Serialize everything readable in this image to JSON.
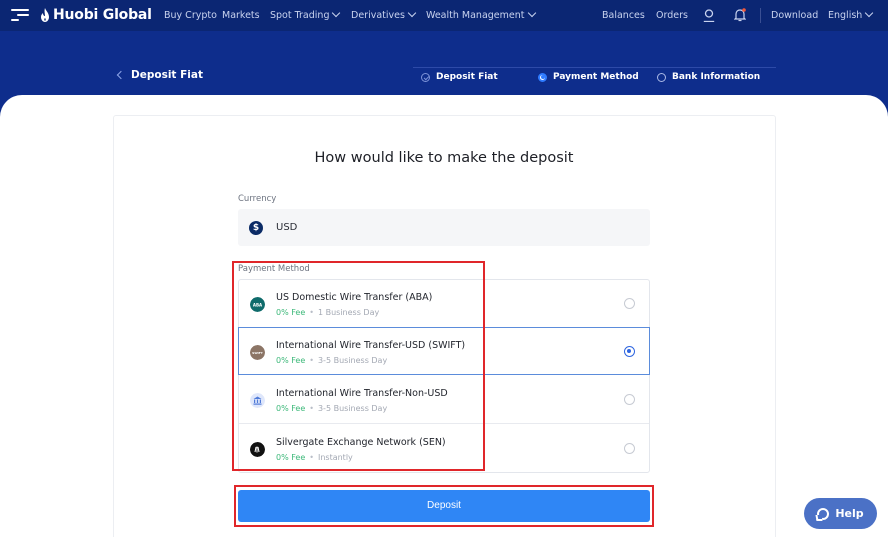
{
  "nav": {
    "brand": "Huobi Global",
    "items": [
      "Buy Crypto",
      "Markets",
      "Spot Trading",
      "Derivatives",
      "Wealth Management"
    ],
    "right": [
      "Balances",
      "Orders",
      "Download",
      "English"
    ]
  },
  "banner": {
    "back_label": "Deposit Fiat",
    "steps": [
      "Deposit Fiat",
      "Payment Method",
      "Bank Information"
    ]
  },
  "form": {
    "heading": "How would like to make the deposit",
    "currency_label": "Currency",
    "currency_value": "USD",
    "payment_label": "Payment Method",
    "methods": [
      {
        "title": "US Domestic Wire Transfer (ABA)",
        "fee": "0% Fee",
        "time": "1 Business Day",
        "icon": "ABA",
        "selected": false
      },
      {
        "title": "International Wire Transfer-USD (SWIFT)",
        "fee": "0% Fee",
        "time": "3-5 Business Day",
        "icon": "SWIFT",
        "selected": true
      },
      {
        "title": "International Wire Transfer-Non-USD",
        "fee": "0% Fee",
        "time": "3-5 Business Day",
        "icon": "bank-icon",
        "selected": false
      },
      {
        "title": "Silvergate Exchange Network (SEN)",
        "fee": "0% Fee",
        "time": "Instantly",
        "icon": "sen-icon",
        "selected": false
      }
    ],
    "deposit_label": "Deposit"
  },
  "help_label": "Help",
  "colors": {
    "nav_bg": "#0b2673",
    "banner_bg": "#0e2d8c",
    "primary": "#2f86f5",
    "fee_green": "#3cb879",
    "highlight_red": "#e0262a"
  }
}
